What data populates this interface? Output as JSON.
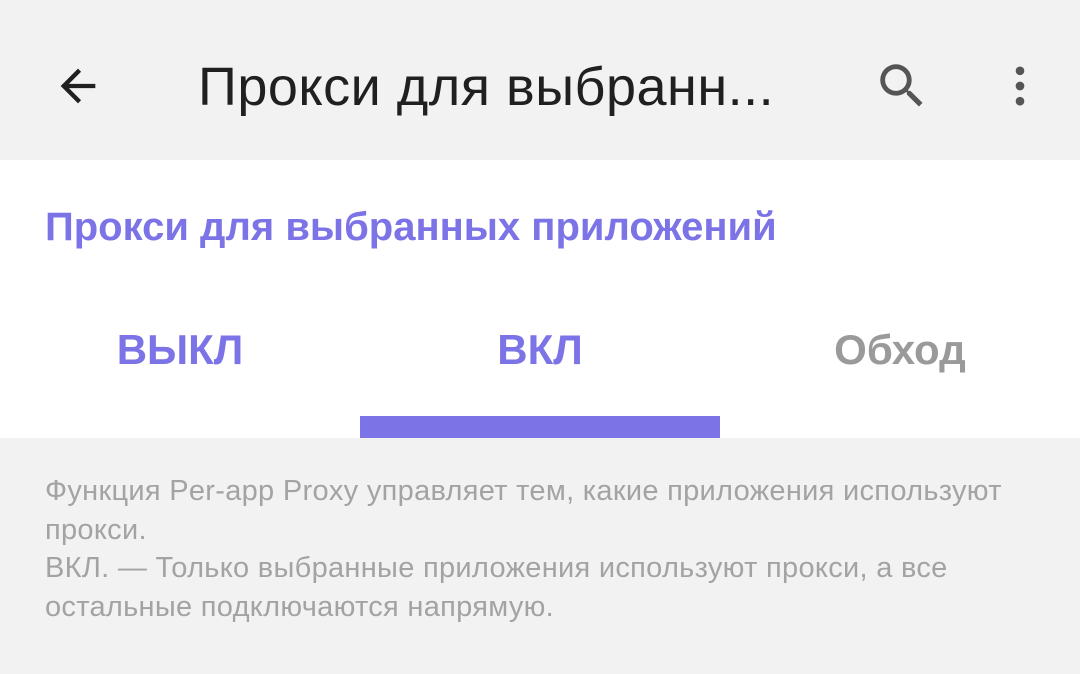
{
  "toolbar": {
    "title": "Прокси для выбранн...",
    "icons": {
      "back": "arrow-back-icon",
      "search": "search-icon",
      "more": "more-vert-icon"
    }
  },
  "section": {
    "title": "Прокси для выбранных приложений"
  },
  "tabs": [
    {
      "label": "ВЫКЛ"
    },
    {
      "label": "ВКЛ",
      "selected": true
    },
    {
      "label": "Обход"
    }
  ],
  "description": {
    "line1": "Функция Per-app Proxy управляет тем, какие приложения используют прокси.",
    "line2": "ВКЛ. — Только выбранные приложения используют прокси, а все остальные подключаются напрямую."
  },
  "colors": {
    "accent": "#7b73e6",
    "inactive_tab": "#9a9a9a",
    "description_text": "#a3a3a3",
    "background": "#f2f2f2"
  }
}
